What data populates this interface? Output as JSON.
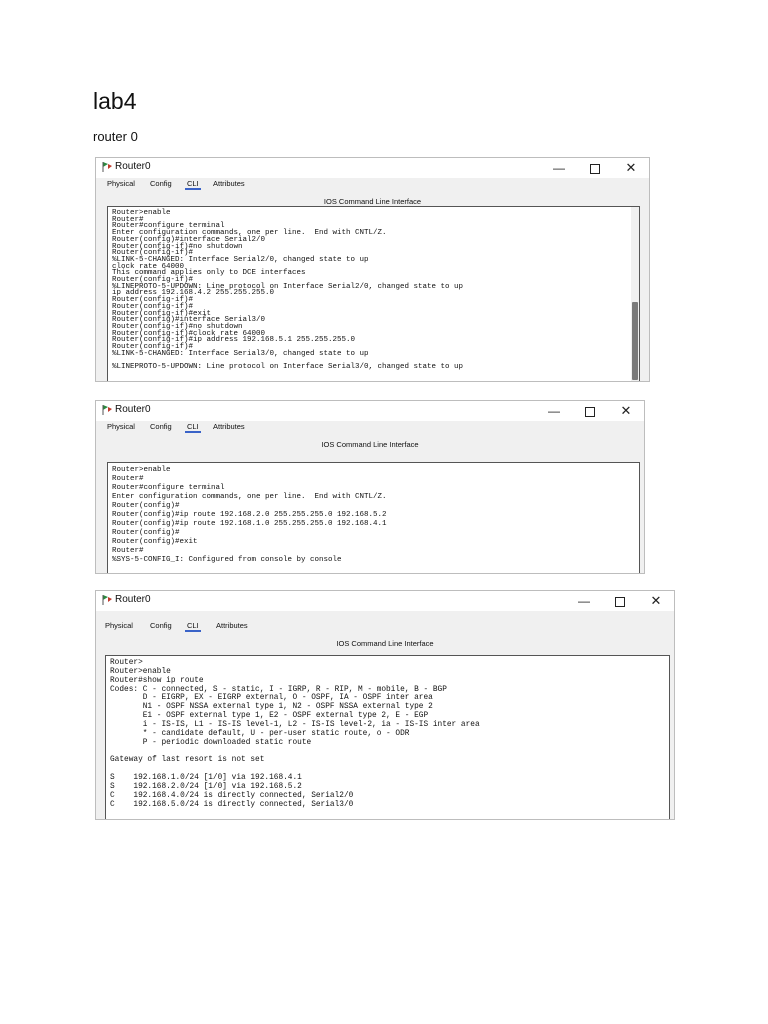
{
  "document": {
    "title": "lab4",
    "subtitle": "router 0"
  },
  "windows": [
    {
      "title": "Router0",
      "tabs": [
        "Physical",
        "Config",
        "CLI",
        "Attributes"
      ],
      "active_tab": "CLI",
      "header": "IOS Command Line Interface",
      "controls": {
        "minimize": "—",
        "maximize": "",
        "close": "✕"
      },
      "console_text": "Router>enable\nRouter#\nRouter#configure terminal\nEnter configuration commands, one per line.  End with CNTL/Z.\nRouter(config)#interface Serial2/0\nRouter(config-if)#no shutdown\nRouter(config-if)#\n%LINK-5-CHANGED: Interface Serial2/0, changed state to up\nclock rate 64000\nThis command applies only to DCE interfaces\nRouter(config-if)#\n%LINEPROTO-5-UPDOWN: Line protocol on Interface Serial2/0, changed state to up\nip address 192.168.4.2 255.255.255.0\nRouter(config-if)#\nRouter(config-if)#\nRouter(config-if)#exit\nRouter(config)#interface Serial3/0\nRouter(config-if)#no shutdown\nRouter(config-if)#clock rate 64000\nRouter(config-if)#ip address 192.168.5.1 255.255.255.0\nRouter(config-if)#\n%LINK-5-CHANGED: Interface Serial3/0, changed state to up\n\n%LINEPROTO-5-UPDOWN: Line protocol on Interface Serial3/0, changed state to up"
    },
    {
      "title": "Router0",
      "tabs": [
        "Physical",
        "Config",
        "CLI",
        "Attributes"
      ],
      "active_tab": "CLI",
      "header": "IOS Command Line Interface",
      "controls": {
        "minimize": "—",
        "maximize": "",
        "close": "✕"
      },
      "console_text": "Router>enable\nRouter#\nRouter#configure terminal\nEnter configuration commands, one per line.  End with CNTL/Z.\nRouter(config)#\nRouter(config)#ip route 192.168.2.0 255.255.255.0 192.168.5.2\nRouter(config)#ip route 192.168.1.0 255.255.255.0 192.168.4.1\nRouter(config)#\nRouter(config)#exit\nRouter#\n%SYS-5-CONFIG_I: Configured from console by console"
    },
    {
      "title": "Router0",
      "tabs": [
        "Physical",
        "Config",
        "CLI",
        "Attributes"
      ],
      "active_tab": "CLI",
      "header": "IOS Command Line Interface",
      "controls": {
        "minimize": "—",
        "maximize": "",
        "close": "✕"
      },
      "console_text": "Router>\nRouter>enable\nRouter#show ip route\nCodes: C - connected, S - static, I - IGRP, R - RIP, M - mobile, B - BGP\n       D - EIGRP, EX - EIGRP external, O - OSPF, IA - OSPF inter area\n       N1 - OSPF NSSA external type 1, N2 - OSPF NSSA external type 2\n       E1 - OSPF external type 1, E2 - OSPF external type 2, E - EGP\n       i - IS-IS, L1 - IS-IS level-1, L2 - IS-IS level-2, ia - IS-IS inter area\n       * - candidate default, U - per-user static route, o - ODR\n       P - periodic downloaded static route\n\nGateway of last resort is not set\n\nS    192.168.1.0/24 [1/0] via 192.168.4.1\nS    192.168.2.0/24 [1/0] via 192.168.5.2\nC    192.168.4.0/24 is directly connected, Serial2/0\nC    192.168.5.0/24 is directly connected, Serial3/0"
    }
  ]
}
